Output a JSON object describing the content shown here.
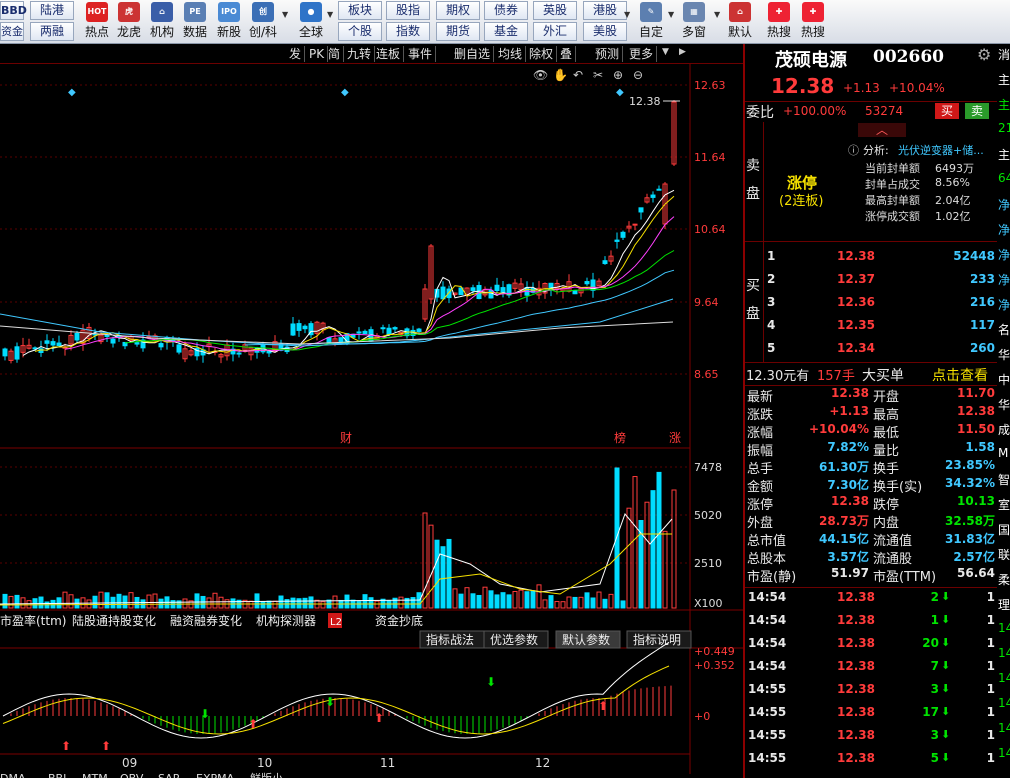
{
  "toolbar": {
    "row1": [
      "陆港",
      "板块",
      "股指",
      "期权",
      "债券",
      "英股",
      "港股"
    ],
    "row2": [
      "两融",
      "个股",
      "指数",
      "期货",
      "基金",
      "外汇",
      "美股"
    ],
    "left_cut_top": "BBD",
    "left_cut_bottom": "资金",
    "icons": [
      {
        "name": "hot-icon",
        "label": "热点",
        "badge": "HOT",
        "color": "#d22"
      },
      {
        "name": "tiger-icon",
        "label": "龙虎",
        "badge": "虎",
        "color": "#c33"
      },
      {
        "name": "bank-icon",
        "label": "机构",
        "badge": "⌂",
        "color": "#3a5ea8"
      },
      {
        "name": "pe-icon",
        "label": "数据",
        "badge": "PE",
        "color": "#5a7fb4"
      },
      {
        "name": "ipo-icon",
        "label": "新股",
        "badge": "IPO",
        "color": "#4a8ad4"
      },
      {
        "name": "chinext-icon",
        "label": "创/科",
        "badge": "创",
        "color": "#3b6fb6"
      },
      {
        "name": "globe-icon",
        "label": "全球",
        "badge": "●",
        "color": "#2f74c8"
      },
      {
        "name": "custom-icon",
        "label": "自定",
        "badge": "✎",
        "color": "#5c7fb0"
      },
      {
        "name": "multi-window-icon",
        "label": "多窗",
        "badge": "▦",
        "color": "#6a86b0"
      },
      {
        "name": "home-icon",
        "label": "默认",
        "badge": "⌂",
        "color": "#c33"
      },
      {
        "name": "hot-search-icon",
        "label": "热搜",
        "badge": "✚",
        "color": "#e23"
      },
      {
        "name": "hot-search-icon-2",
        "label": "热搜",
        "badge": "✚",
        "color": "#e23"
      }
    ]
  },
  "chart_tabs": [
    "发",
    "PK",
    "简",
    "九转",
    "连板",
    "事件",
    "删自选",
    "均线",
    "除权",
    "叠",
    "预测",
    "更多"
  ],
  "price_axis": [
    "12.63",
    "11.64",
    "10.64",
    "9.64",
    "8.65"
  ],
  "last_price_tag": "12.38",
  "event_marks": [
    "财",
    "榜",
    "涨"
  ],
  "volume_axis": [
    "7478",
    "5020",
    "2510",
    "X100"
  ],
  "indicator_tabs": [
    "市盈率(ttm)",
    "陆股通持股变化",
    "融资融券变化",
    "机构探测器",
    "资金抄底"
  ],
  "l2_badge": "L2",
  "macd_tabs": [
    "指标战法",
    "优选参数",
    "默认参数",
    "指标说明"
  ],
  "macd_axis": [
    "+0.449",
    "+0.352",
    "+0"
  ],
  "months": [
    "09",
    "10",
    "11",
    "12"
  ],
  "bottom_tabs": [
    "DMA",
    "BBI",
    "MTM",
    "OBV",
    "SAR",
    "EXPMA",
    "鲜版小"
  ],
  "stock": {
    "name": "茂硕电源",
    "code": "002660",
    "price": "12.38",
    "change": "+1.13",
    "pct": "+10.04%"
  },
  "weibi": {
    "label": "委比",
    "pct": "+100.00%",
    "diff": "53274",
    "buy": "买",
    "sell": "卖"
  },
  "analysis": {
    "head": "分析:",
    "text": "光伏逆变器+储...",
    "limit_up": "涨停",
    "limit_sub": "(2连板)",
    "rows": [
      [
        "当前封单额",
        "6493万"
      ],
      [
        "封单占成交",
        "8.56%"
      ],
      [
        "最高封单额",
        "2.04亿"
      ],
      [
        "涨停成交额",
        "1.02亿"
      ]
    ]
  },
  "sell_label": "卖盘",
  "buy_label": "买盘",
  "bids": [
    [
      "1",
      "12.38",
      "52448"
    ],
    [
      "2",
      "12.37",
      "233"
    ],
    [
      "3",
      "12.36",
      "216"
    ],
    [
      "4",
      "12.35",
      "117"
    ],
    [
      "5",
      "12.34",
      "260"
    ]
  ],
  "big_order": {
    "price": "12.30元有",
    "qty": "157手",
    "kind": "大买单",
    "link": "点击查看"
  },
  "quote": [
    [
      "最新",
      "12.38",
      "开盘",
      "11.70"
    ],
    [
      "涨跌",
      "+1.13",
      "最高",
      "12.38"
    ],
    [
      "涨幅",
      "+10.04%",
      "最低",
      "11.50"
    ],
    [
      "振幅",
      "7.82%",
      "量比",
      "1.58"
    ],
    [
      "总手",
      "61.30万",
      "换手",
      "23.85%"
    ],
    [
      "金额",
      "7.30亿",
      "换手(实)",
      "34.32%"
    ],
    [
      "涨停",
      "12.38",
      "跌停",
      "10.13"
    ],
    [
      "外盘",
      "28.73万",
      "内盘",
      "32.58万"
    ],
    [
      "总市值",
      "44.15亿",
      "流通值",
      "31.83亿"
    ],
    [
      "总股本",
      "3.57亿",
      "流通股",
      "2.57亿"
    ],
    [
      "市盈(静)",
      "51.97",
      "市盈(TTM)",
      "56.64"
    ]
  ],
  "ticks": [
    [
      "14:54",
      "12.38",
      "2",
      "1"
    ],
    [
      "14:54",
      "12.38",
      "1",
      "1"
    ],
    [
      "14:54",
      "12.38",
      "20",
      "1"
    ],
    [
      "14:54",
      "12.38",
      "7",
      "1"
    ],
    [
      "14:55",
      "12.38",
      "3",
      "1"
    ],
    [
      "14:55",
      "12.38",
      "17",
      "1"
    ],
    [
      "14:55",
      "12.38",
      "3",
      "1"
    ],
    [
      "14:55",
      "12.38",
      "5",
      "1"
    ]
  ],
  "edge_chars": [
    "消",
    "主",
    "主",
    "21",
    "主",
    "64",
    "净",
    "净",
    "净",
    "净",
    "净",
    "名",
    "华",
    "中",
    "华",
    "成",
    "M",
    "智",
    "室",
    "国",
    "联",
    "柔",
    "理",
    "14",
    "14",
    "14",
    "14",
    "14",
    "14"
  ]
}
